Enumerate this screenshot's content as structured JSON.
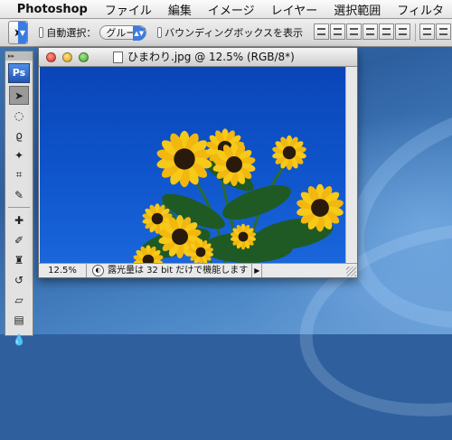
{
  "menubar": {
    "apple": "",
    "app_name": "Photoshop",
    "items": [
      "ファイル",
      "編集",
      "イメージ",
      "レイヤー",
      "選択範囲",
      "フィルタ"
    ]
  },
  "options_bar": {
    "auto_select_label": "自動選択：",
    "auto_select_value": "グループ",
    "bounding_box_label": "バウンディングボックスを表示"
  },
  "toolbox": {
    "logo": "Ps",
    "tools": [
      "move-tool",
      "marquee-tool",
      "lasso-tool",
      "magic-wand-tool",
      "crop-tool",
      "slice-tool",
      "healing-brush-tool",
      "brush-tool",
      "clone-stamp-tool",
      "history-brush-tool",
      "eraser-tool",
      "gradient-tool",
      "blur-tool",
      "dodge-tool"
    ]
  },
  "document": {
    "title": "ひまわり.jpg @ 12.5% (RGB/8*)",
    "zoom": "12.5%",
    "status_message": "露光量は 32 bit だけで機能します",
    "sky_color": "#0f55cc"
  }
}
